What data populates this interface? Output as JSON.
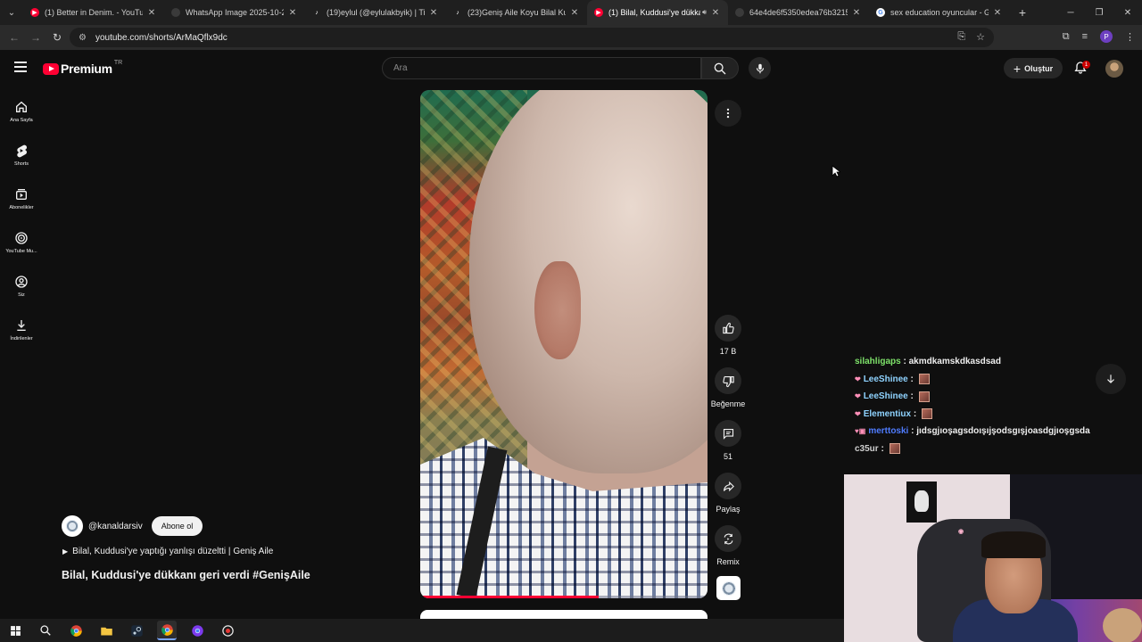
{
  "browser": {
    "tabs": [
      {
        "title": "(1) Better in Denim. - YouTube",
        "favicon": "youtube-icon",
        "active": false
      },
      {
        "title": "WhatsApp Image 2025-10-22 a",
        "favicon": "globe-icon",
        "active": false
      },
      {
        "title": "(19)eylul (@eylulakbyik) | TikTo",
        "favicon": "tiktok-icon",
        "active": false
      },
      {
        "title": "(23)Geniş Aile Koyu Bilal Kuruy",
        "favicon": "tiktok-icon",
        "active": false
      },
      {
        "title": "(1) Bilal, Kuddusi'ye dükkan",
        "favicon": "youtube-icon",
        "active": true
      },
      {
        "title": "64e4de6f5350edea76b321510",
        "favicon": "globe-icon",
        "active": false
      },
      {
        "title": "sex education oyuncular - Goo",
        "favicon": "google-icon",
        "active": false
      }
    ],
    "url": "youtube.com/shorts/ArMaQflx9dc",
    "profile_initial": "P"
  },
  "youtube": {
    "logo_text": "Premium",
    "country": "TR",
    "search_placeholder": "Ara",
    "create_label": "Oluştur",
    "notification_count": "1",
    "guide": [
      {
        "label": "Ana Sayfa",
        "icon": "home-icon"
      },
      {
        "label": "Shorts",
        "icon": "shorts-icon"
      },
      {
        "label": "Abonelikler",
        "icon": "subscriptions-icon"
      },
      {
        "label": "YouTube Mu...",
        "icon": "youtube-music-icon"
      },
      {
        "label": "Siz",
        "icon": "you-icon"
      },
      {
        "label": "İndirilenler",
        "icon": "download-icon"
      }
    ],
    "short": {
      "likes": "17 B",
      "dislike_label": "Beğenme",
      "comments": "51",
      "share_label": "Paylaş",
      "remix_label": "Remix",
      "channel_handle": "@kanaldarsiv",
      "subscribe_label": "Abone ol",
      "playlist": "Bilal, Kuddusi'ye yaptığı yanlışı düzeltti | Geniş Aile",
      "title": "Bilal, Kuddusi'ye dükkanı geri verdi #GenişAile",
      "progress": 0.62
    }
  },
  "chat": [
    {
      "user": "silahligaps",
      "user_color": "#7ee26a",
      "badge": "",
      "message": "akmdkamskdkasdsad",
      "emote": false
    },
    {
      "user": "LeeShinee",
      "user_color": "#8fd3ff",
      "badge": "❤",
      "message": "",
      "emote": true
    },
    {
      "user": "LeeShinee",
      "user_color": "#8fd3ff",
      "badge": "❤",
      "message": "",
      "emote": true
    },
    {
      "user": "Elementiux",
      "user_color": "#8fd3ff",
      "badge": "❤",
      "message": "",
      "emote": true
    },
    {
      "user": "merttoski",
      "user_color": "#4f7cff",
      "badge": "♥▣",
      "message": "jıdsgjıoşagsdoışıjşodsgışjoasdgjıoşgsda",
      "emote": false
    },
    {
      "user": "c35ur",
      "user_color": "#d0d0d0",
      "badge": "",
      "message": "",
      "emote": true
    }
  ],
  "colors": {
    "brand_red": "#ff0033",
    "background": "#0f0f0f"
  }
}
